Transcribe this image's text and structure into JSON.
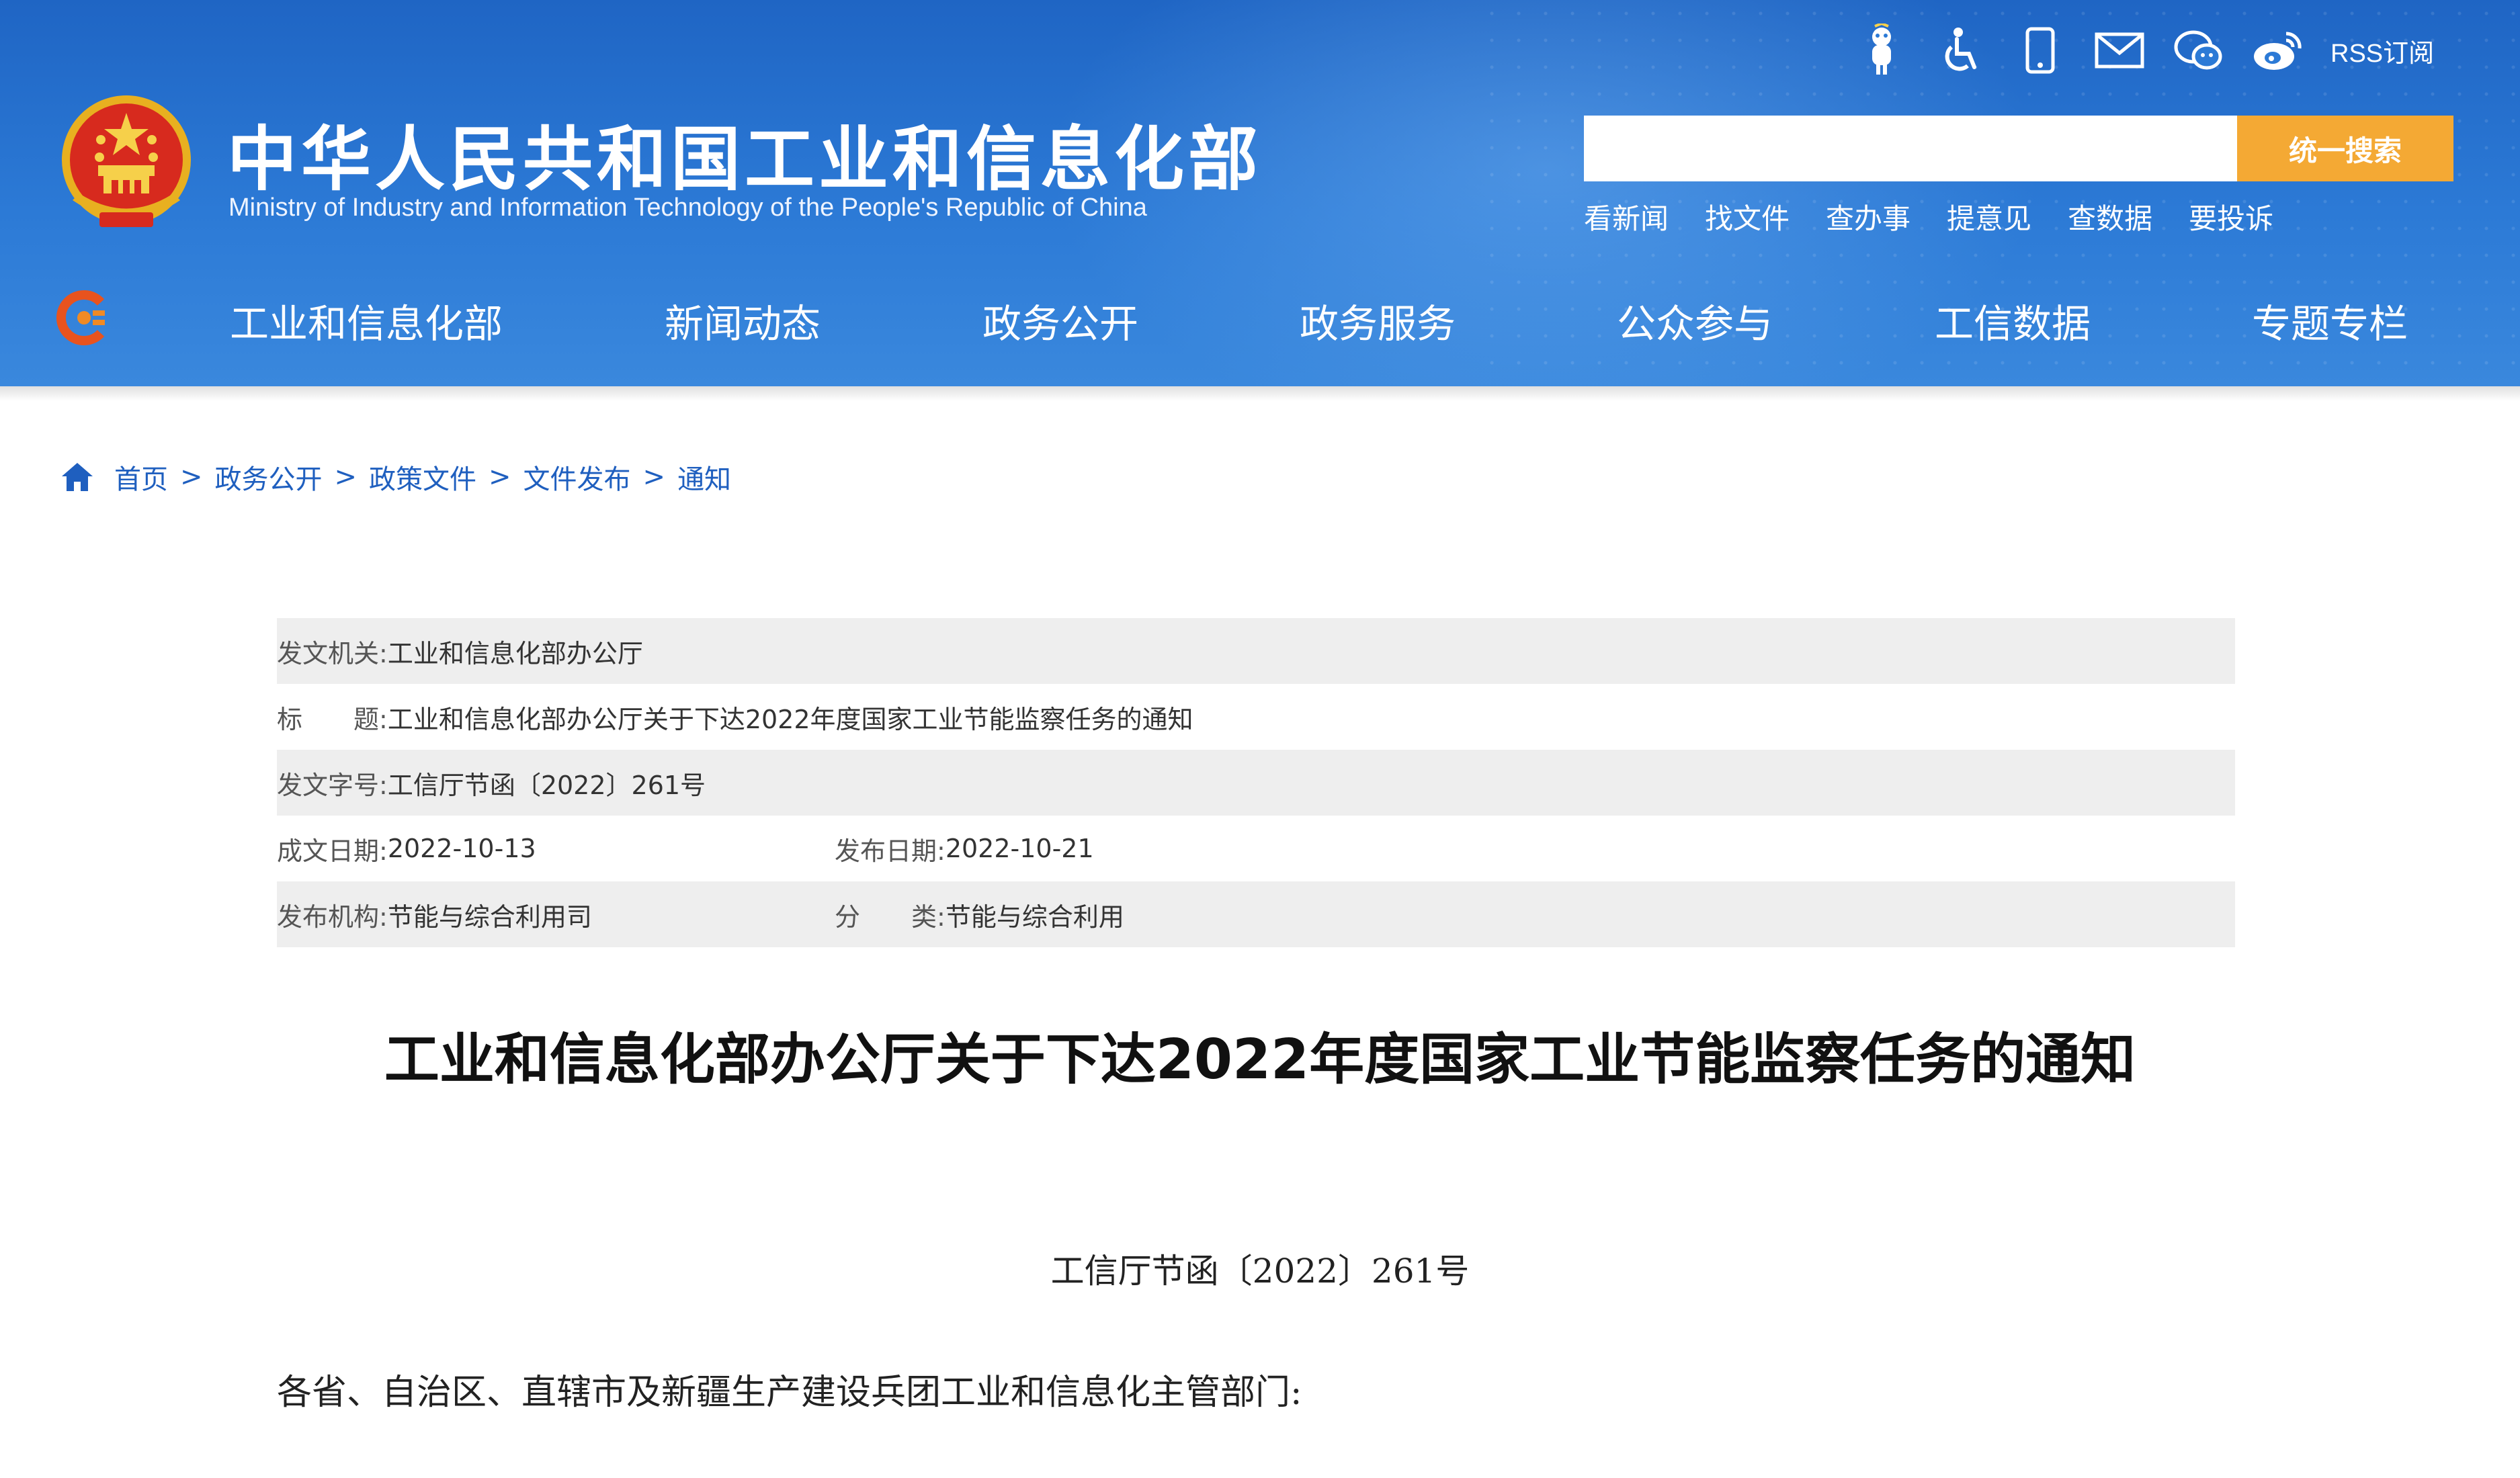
{
  "header": {
    "title": "中华人民共和国工业和信息化部",
    "subtitle": "Ministry of Industry and Information Technology of the People's Republic of China",
    "utility_icons": [
      "mascot-icon",
      "accessibility-icon",
      "mobile-icon",
      "mail-icon",
      "wechat-icon",
      "weibo-icon"
    ],
    "rss_label": "RSS订阅",
    "search": {
      "placeholder": "",
      "value": "",
      "button_label": "统一搜索"
    },
    "quick_links": [
      "看新闻",
      "找文件",
      "查办事",
      "提意见",
      "查数据",
      "要投诉"
    ],
    "nav": [
      "工业和信息化部",
      "新闻动态",
      "政务公开",
      "政务服务",
      "公众参与",
      "工信数据",
      "专题专栏"
    ],
    "colors": {
      "header_blue": "#2c7ad6",
      "search_button": "#f4a934",
      "link_blue": "#1f5fbf"
    }
  },
  "breadcrumb": {
    "separator": ">",
    "items": [
      "首页",
      "政务公开",
      "政策文件",
      "文件发布",
      "通知"
    ]
  },
  "meta": {
    "issuer_label": "发文机关:",
    "issuer": "工业和信息化部办公厅",
    "title_label": "标　　题:",
    "title": "工业和信息化部办公厅关于下达2022年度国家工业节能监察任务的通知",
    "doc_no_label": "发文字号:",
    "doc_no": "工信厅节函〔2022〕261号",
    "written_date_label": "成文日期:",
    "written_date": "2022-10-13",
    "publish_date_label": "发布日期:",
    "publish_date": "2022-10-21",
    "publisher_label": "发布机构:",
    "publisher": "节能与综合利用司",
    "category_label": "分　　类:",
    "category": "节能与综合利用"
  },
  "article": {
    "title": "工业和信息化部办公厅关于下达2022年度国家工业节能监察任务的通知",
    "doc_number": "工信厅节函〔2022〕261号",
    "recipients": "各省、自治区、直辖市及新疆生产建设兵团工业和信息化主管部门:"
  }
}
